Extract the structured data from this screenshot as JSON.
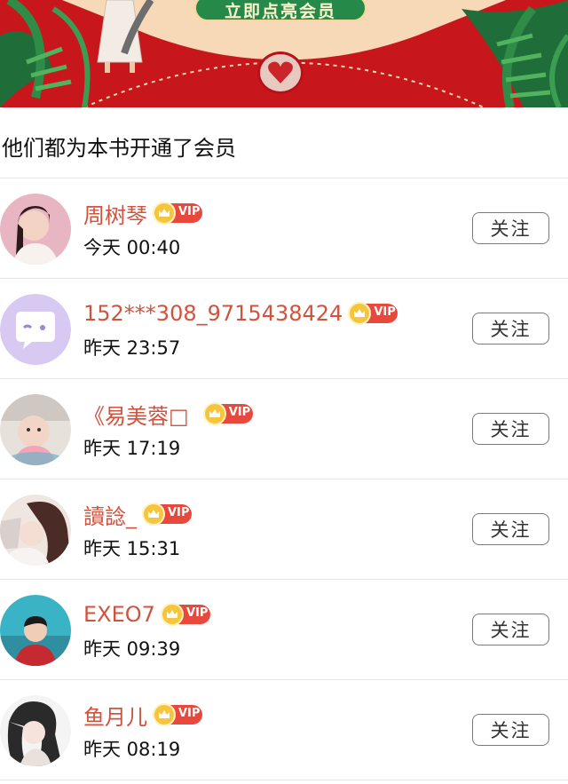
{
  "banner": {
    "cta_label": "立即点亮会员"
  },
  "section": {
    "title": "他们都为本书开通了会员"
  },
  "members": [
    {
      "name": "周树琴",
      "badge": "VIP",
      "time": "今天 00:40",
      "follow_label": "关注",
      "avatar_icon": "avatar-photo-girl"
    },
    {
      "name": "152***308_9715438424",
      "badge": "VIP",
      "time": "昨天 23:57",
      "follow_label": "关注",
      "avatar_icon": "avatar-default-chat"
    },
    {
      "name": "《易美蓉□",
      "badge": "VIP",
      "time": "昨天 17:19",
      "follow_label": "关注",
      "avatar_icon": "avatar-photo-baby"
    },
    {
      "name": "讀諗_",
      "badge": "VIP",
      "time": "昨天 15:31",
      "follow_label": "关注",
      "avatar_icon": "avatar-illustration-girl"
    },
    {
      "name": "EXEO7",
      "badge": "VIP",
      "time": "昨天 09:39",
      "follow_label": "关注",
      "avatar_icon": "avatar-photo-boy"
    },
    {
      "name": "鱼月儿",
      "badge": "VIP",
      "time": "昨天 08:19",
      "follow_label": "关注",
      "avatar_icon": "avatar-illustration-woman"
    }
  ],
  "colors": {
    "banner_red": "#c4151c",
    "name_red": "#d0533e",
    "vip_red": "#e9483c",
    "cta_green": "#25894a"
  }
}
